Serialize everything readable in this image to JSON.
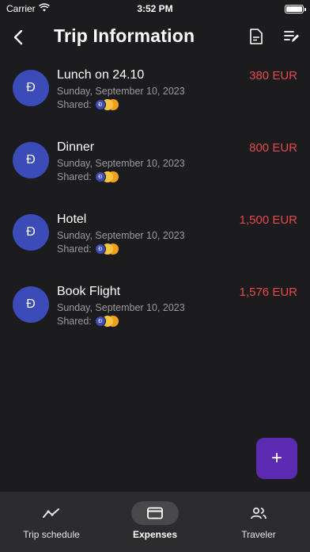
{
  "status_bar": {
    "carrier": "Carrier",
    "time": "3:52 PM"
  },
  "header": {
    "title": "Trip Information"
  },
  "expenses": [
    {
      "avatar": "Đ",
      "title": "Lunch on 24.10",
      "amount": "380 EUR",
      "date": "Sunday, September 10, 2023",
      "shared_label": "Shared:"
    },
    {
      "avatar": "Đ",
      "title": "Dinner",
      "amount": "800 EUR",
      "date": "Sunday, September 10, 2023",
      "shared_label": "Shared:"
    },
    {
      "avatar": "Đ",
      "title": "Hotel",
      "amount": "1,500 EUR",
      "date": "Sunday, September 10, 2023",
      "shared_label": "Shared:"
    },
    {
      "avatar": "Đ",
      "title": "Book Flight",
      "amount": "1,576 EUR",
      "date": "Sunday, September 10, 2023",
      "shared_label": "Shared:"
    }
  ],
  "shared_chip": "Đ",
  "fab": {
    "icon": "plus-icon",
    "label": "+"
  },
  "tabs": [
    {
      "label": "Trip schedule",
      "icon": "trend-line-icon",
      "active": false
    },
    {
      "label": "Expenses",
      "icon": "card-icon",
      "active": true
    },
    {
      "label": "Traveler",
      "icon": "people-icon",
      "active": false
    }
  ],
  "colors": {
    "background": "#1c1c1e",
    "amount": "#e5484d",
    "avatar": "#3b4bb8",
    "fab": "#5a2bb0",
    "tabbar": "#2c2c2e"
  }
}
